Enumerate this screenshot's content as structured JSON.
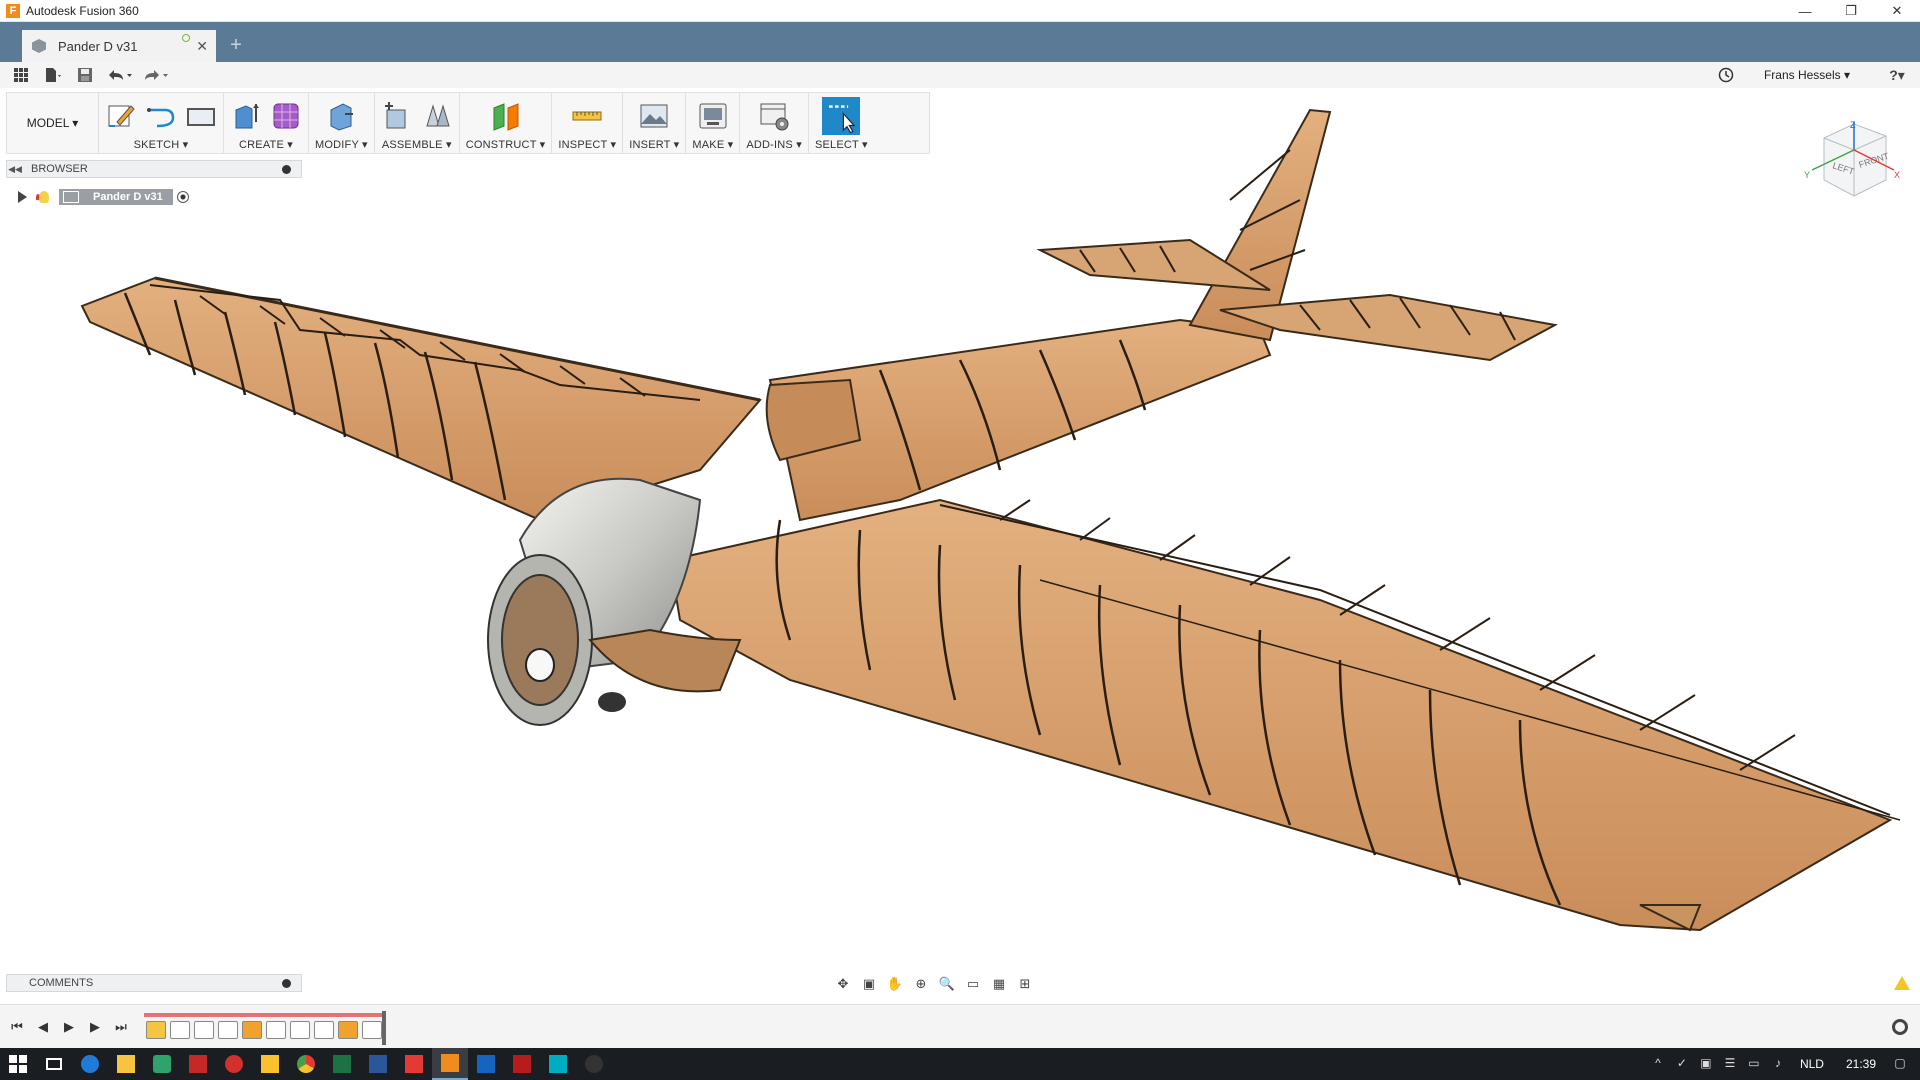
{
  "window": {
    "title": "Autodesk Fusion 360",
    "controls": [
      "—",
      "❐",
      "✕"
    ]
  },
  "tab": {
    "label": "Pander D v31",
    "close": "✕",
    "new": "+"
  },
  "quick_access": {
    "user_name": "Frans Hessels ▾",
    "help": "?▾"
  },
  "toolbar": {
    "workspace": "MODEL ▾",
    "groups": [
      {
        "label": "SKETCH ▾"
      },
      {
        "label": "CREATE ▾"
      },
      {
        "label": "MODIFY ▾"
      },
      {
        "label": "ASSEMBLE ▾"
      },
      {
        "label": "CONSTRUCT ▾"
      },
      {
        "label": "INSPECT ▾"
      },
      {
        "label": "INSERT ▾"
      },
      {
        "label": "MAKE ▾"
      },
      {
        "label": "ADD-INS ▾"
      },
      {
        "label": "SELECT ▾"
      }
    ]
  },
  "browser": {
    "title": "BROWSER",
    "root_component": "Pander D v31"
  },
  "comments": {
    "title": "COMMENTS"
  },
  "viewcube": {
    "left": "LEFT",
    "front": "FRONT",
    "z": "Z",
    "x": "X",
    "y": "Y"
  },
  "taskbar": {
    "language": "NLD",
    "time": "21:39"
  },
  "colors": {
    "tabbar": "#5b7a96",
    "wood": "#d9a070",
    "select_active": "#1e88c8"
  }
}
